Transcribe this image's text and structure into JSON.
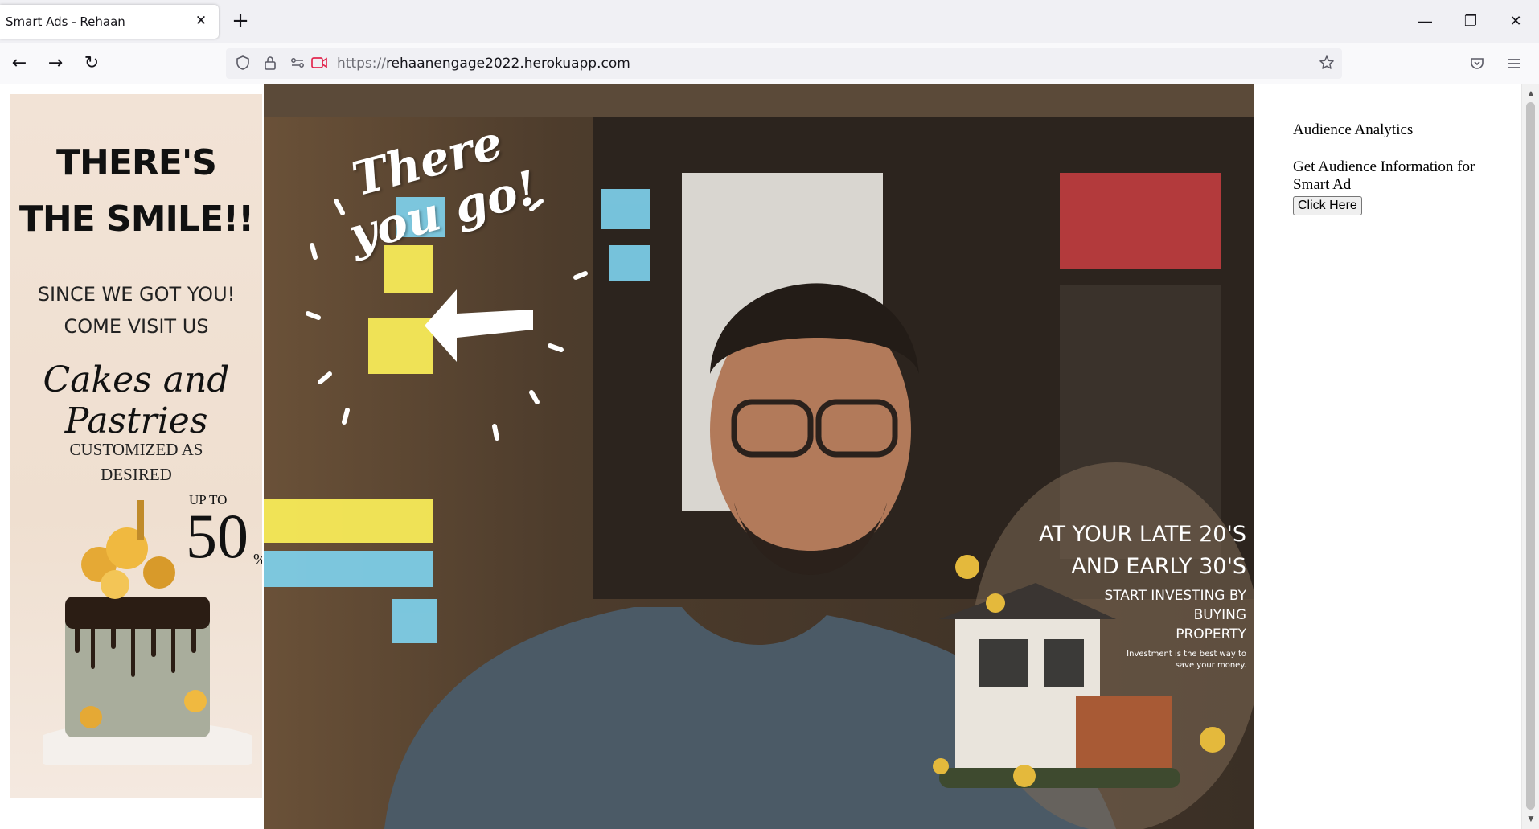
{
  "browser": {
    "tab_title": "Smart Ads - Rehaan",
    "tab_close": "✕",
    "new_tab": "+",
    "url_protocol": "https://",
    "url_host": "rehaanengage2022.herokuapp.com",
    "window_buttons": {
      "minimize": "—",
      "restore": "❐",
      "close": "✕"
    },
    "nav": {
      "back": "←",
      "forward": "→",
      "reload": "↻"
    }
  },
  "left_ad": {
    "line1": "THERE'S",
    "line2": "THE SMILE!!",
    "line3": "SINCE WE GOT YOU!",
    "line4": "COME VISIT US",
    "script": "Cakes and Pastries",
    "custom1": "CUSTOMIZED AS",
    "custom2": "DESIRED",
    "upto": "UP TO",
    "discount": "50",
    "percent": "%"
  },
  "video_overlay": {
    "sticker_line1": "There",
    "sticker_line2": "you go!",
    "house_ad": {
      "headline1": "AT YOUR LATE 20'S",
      "headline2": "AND EARLY 30'S",
      "sub1": "START INVESTING BY",
      "sub2": "BUYING",
      "sub3": "PROPERTY",
      "small1": "Investment is the best way to",
      "small2": "save your money."
    }
  },
  "panel": {
    "title": "Audience Analytics",
    "description": "Get Audience Information for Smart Ad",
    "button_label": "Click Here"
  }
}
